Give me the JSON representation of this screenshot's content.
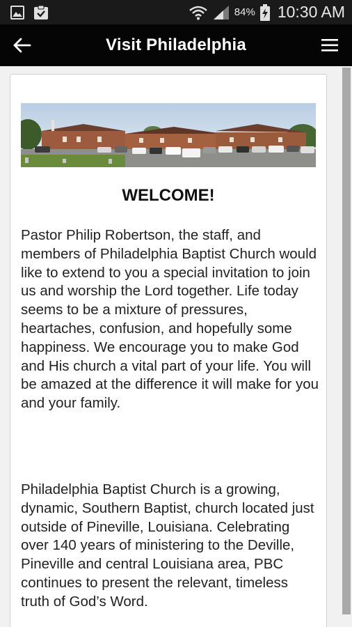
{
  "status_bar": {
    "battery_percent": "84%",
    "time": "10:30 AM",
    "icons": [
      "gallery-icon",
      "clipboard-check-icon",
      "wifi-icon",
      "signal-icon",
      "battery-charging-icon"
    ]
  },
  "app_bar": {
    "title": "Visit Philadelphia",
    "back_icon": "arrow-left-icon",
    "menu_icon": "hamburger-menu-icon"
  },
  "content": {
    "banner": "church building with parking lot",
    "heading": "WELCOME!",
    "paragraphs": [
      "Pastor Philip Robertson, the staff, and members of Philadelphia Baptist Church would like to extend to you a special invitation to join us and worship the Lord together. Life today seems to be a mixture of pressures, heartaches, confusion, and hopefully some happiness. We encourage you to make God and His church a vital part of your life. You will be amazed at the difference it will make for you and your family.",
      "Philadelphia Baptist Church is a growing, dynamic, Southern Baptist, church located just outside of Pineville, Louisiana. Celebrating over 140 years of ministering to the Deville, Pineville and central Louisiana area, PBC continues to present the relevant, timeless truth of God’s Word."
    ]
  },
  "colors": {
    "status_bar_bg": "#1a1a1a",
    "app_bar_bg": "#050505",
    "page_bg": "#f1f1f1",
    "card_bg": "#ffffff",
    "scrollbar": "#a9a9a9"
  }
}
